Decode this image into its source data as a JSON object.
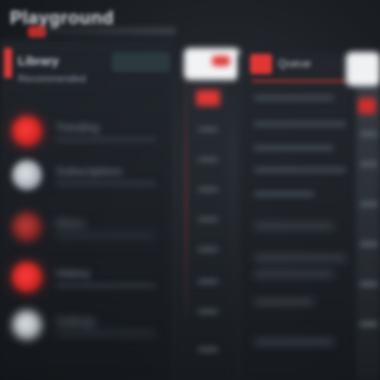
{
  "app": {
    "title": "Playground"
  },
  "left": {
    "header_title": "Library",
    "header_subtitle": "Recommended",
    "items": [
      {
        "icon": "red-circle-icon",
        "label": "Trending"
      },
      {
        "icon": "grey-circle-icon",
        "label": "Subscriptions"
      },
      {
        "icon": "dim-red-circle-icon",
        "label": "Mixes"
      },
      {
        "icon": "red-circle-icon",
        "label": "History"
      },
      {
        "icon": "grey-circle-icon",
        "label": "Settings"
      }
    ]
  },
  "right": {
    "header_label": "Queue"
  },
  "colors": {
    "accent_red": "#e03734",
    "background": "#1b1f24",
    "text_primary": "#cfd4da",
    "text_muted": "#7f8891"
  }
}
